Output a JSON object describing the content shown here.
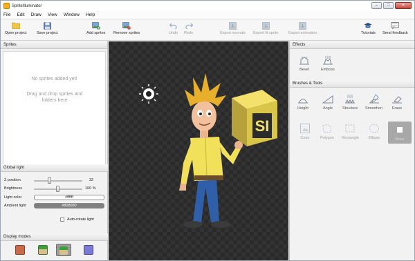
{
  "window": {
    "title": "SpriteIlluminator",
    "minimize": "–",
    "maximize": "□",
    "close": "✕"
  },
  "menu": [
    "File",
    "Edit",
    "Draw",
    "View",
    "Window",
    "Help"
  ],
  "toolbar": {
    "open_project": "Open project",
    "save_project": "Save project",
    "add_sprites": "Add sprites",
    "remove_sprites": "Remove sprites",
    "undo": "Undo",
    "redo": "Redo",
    "export_normals": "Export normals",
    "export_lit_sprite": "Export lit sprite",
    "export_animation": "Export animation",
    "tutorials": "Tutorials",
    "send_feedback": "Send feedback"
  },
  "sprites_panel": {
    "title": "Sprites",
    "empty_title": "No sprites added yet!",
    "empty_hint": "Drag and drop sprites and folders here"
  },
  "global_light": {
    "title": "Global light",
    "z_position_label": "Z position",
    "z_position_value": "32",
    "z_position_fraction": 0.32,
    "brightness_label": "Brightness",
    "brightness_value": "100 %",
    "brightness_fraction": 0.5,
    "light_color_label": "Light color",
    "light_color_value": "#ffffff",
    "ambient_light_label": "Ambient light",
    "ambient_light_value": "#808080",
    "auto_rotate_label": "Auto-rotate light"
  },
  "display_modes": {
    "title": "Display modes"
  },
  "canvas": {
    "cube_label": "SI"
  },
  "effects": {
    "title": "Effects",
    "bevel": "Bevel",
    "emboss": "Emboss"
  },
  "brushes": {
    "title": "Brushes & Tools",
    "height": "Height",
    "angle": "Angle",
    "structure": "Structure",
    "smoothen": "Smoothen",
    "erase": "Erase",
    "color": "Color",
    "polygon": "Polygon",
    "rectangle": "Rectangle",
    "ellipse": "Ellipse",
    "move": "Move"
  },
  "colors": {
    "accent": "#f3b21b",
    "canvas_bg": "#2a2a2a",
    "shirt": "#f1e05a",
    "jeans": "#2f5fa8"
  }
}
